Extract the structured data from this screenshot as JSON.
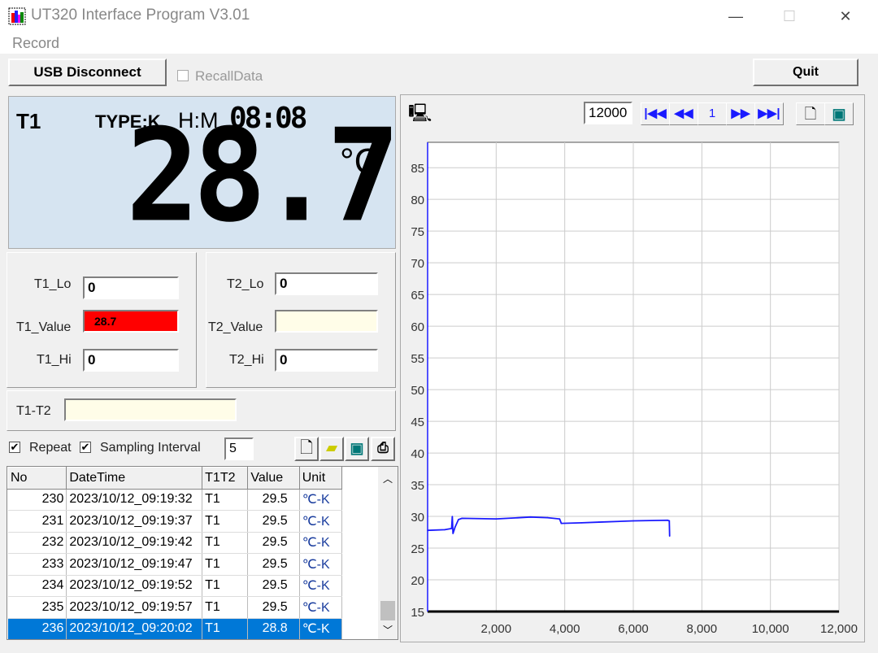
{
  "window": {
    "title": "UT320 Interface Program V3.01",
    "menu": [
      "Record"
    ]
  },
  "toolbar": {
    "usb_button": "USB Disconnect",
    "recall_label": "RecallData",
    "recall_checked": false,
    "quit_button": "Quit"
  },
  "lcd": {
    "channel": "T1",
    "type": "TYPE:K",
    "hm_label": "H:M",
    "time": "08:08",
    "reading": "28.7",
    "unit": "°C"
  },
  "t1": {
    "lo_label": "T1_Lo",
    "lo": "0",
    "value_label": "T1_Value",
    "value": "28.7",
    "hi_label": "T1_Hi",
    "hi": "0",
    "value_color": "#ff0000"
  },
  "t2": {
    "lo_label": "T2_Lo",
    "lo": "0",
    "value_label": "T2_Value",
    "value": "",
    "hi_label": "T2_Hi",
    "hi": "0"
  },
  "diff": {
    "label": "T1-T2",
    "value": ""
  },
  "sampling": {
    "repeat_label": "Repeat",
    "repeat_checked": true,
    "interval_label": "Sampling Interval",
    "interval_checked": true,
    "interval": "5"
  },
  "table": {
    "columns": [
      "No",
      "DateTime",
      "T1T2",
      "Value",
      "Unit"
    ],
    "rows": [
      [
        "230",
        "2023/10/12_09:19:32",
        "T1",
        "29.5",
        "℃-K"
      ],
      [
        "231",
        "2023/10/12_09:19:37",
        "T1",
        "29.5",
        "℃-K"
      ],
      [
        "232",
        "2023/10/12_09:19:42",
        "T1",
        "29.5",
        "℃-K"
      ],
      [
        "233",
        "2023/10/12_09:19:47",
        "T1",
        "29.5",
        "℃-K"
      ],
      [
        "234",
        "2023/10/12_09:19:52",
        "T1",
        "29.5",
        "℃-K"
      ],
      [
        "235",
        "2023/10/12_09:19:57",
        "T1",
        "29.5",
        "℃-K"
      ],
      [
        "236",
        "2023/10/12_09:20:02",
        "T1",
        "28.8",
        "℃-K"
      ]
    ],
    "selected_row": 6
  },
  "graph_nav": {
    "points": "12000",
    "page": "1"
  },
  "chart_data": {
    "type": "line",
    "xlim": [
      0,
      12000
    ],
    "ylim": [
      15,
      89
    ],
    "xticks": [
      2000,
      4000,
      6000,
      8000,
      10000,
      12000
    ],
    "xtick_labels": [
      "2,000",
      "4,000",
      "6,000",
      "8,000",
      "10,000",
      "12,000"
    ],
    "yticks": [
      15,
      20,
      25,
      30,
      35,
      40,
      45,
      50,
      55,
      60,
      65,
      70,
      75,
      80,
      85
    ],
    "grid": true,
    "line_color": "#1a1aff",
    "x": [
      0,
      500,
      700,
      720,
      740,
      800,
      900,
      1000,
      2000,
      3000,
      3500,
      3850,
      3900,
      4500,
      5000,
      6000,
      7000,
      7050,
      7060
    ],
    "y": [
      27.8,
      27.9,
      28.1,
      30.0,
      27.3,
      28.3,
      29.5,
      29.7,
      29.6,
      29.9,
      29.8,
      29.6,
      28.9,
      29.0,
      29.1,
      29.3,
      29.4,
      29.3,
      26.9
    ]
  }
}
